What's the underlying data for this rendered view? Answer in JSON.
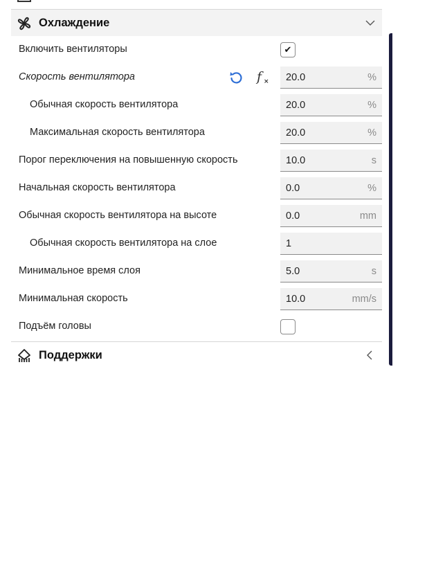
{
  "cooling": {
    "title": "Охлаждение",
    "rows": [
      {
        "label": "Включить вентиляторы",
        "type": "checkbox",
        "checked": true,
        "mark": "✔"
      },
      {
        "label": "Скорость вентилятора",
        "type": "field",
        "value": "20.0",
        "unit": "%"
      },
      {
        "label": "Обычная скорость вентилятора",
        "type": "field",
        "value": "20.0",
        "unit": "%"
      },
      {
        "label": "Максимальная скорость вентилятора",
        "type": "field",
        "value": "20.0",
        "unit": "%"
      },
      {
        "label": "Порог переключения на повышенную скорость",
        "type": "field",
        "value": "10.0",
        "unit": "s"
      },
      {
        "label": "Начальная скорость вентилятора",
        "type": "field",
        "value": "0.0",
        "unit": "%"
      },
      {
        "label": "Обычная скорость вентилятора на высоте",
        "type": "field",
        "value": "0.0",
        "unit": "mm"
      },
      {
        "label": "Обычная скорость вентилятора на слое",
        "type": "field",
        "value": "1",
        "unit": ""
      },
      {
        "label": "Минимальное время слоя",
        "type": "field",
        "value": "5.0",
        "unit": "s"
      },
      {
        "label": "Минимальная скорость",
        "type": "field",
        "value": "10.0",
        "unit": "mm/s"
      },
      {
        "label": "Подъём головы",
        "type": "checkbox",
        "checked": false,
        "mark": ""
      }
    ]
  },
  "supports": {
    "title": "Поддержки"
  },
  "icons": {
    "cooling": "fan-icon",
    "supports": "support-icon",
    "reset": "reset-icon",
    "formula": "formula-fx-icon"
  },
  "colors": {
    "accent": "#2f6fd6",
    "scrollbar": "#1b1c3d"
  }
}
